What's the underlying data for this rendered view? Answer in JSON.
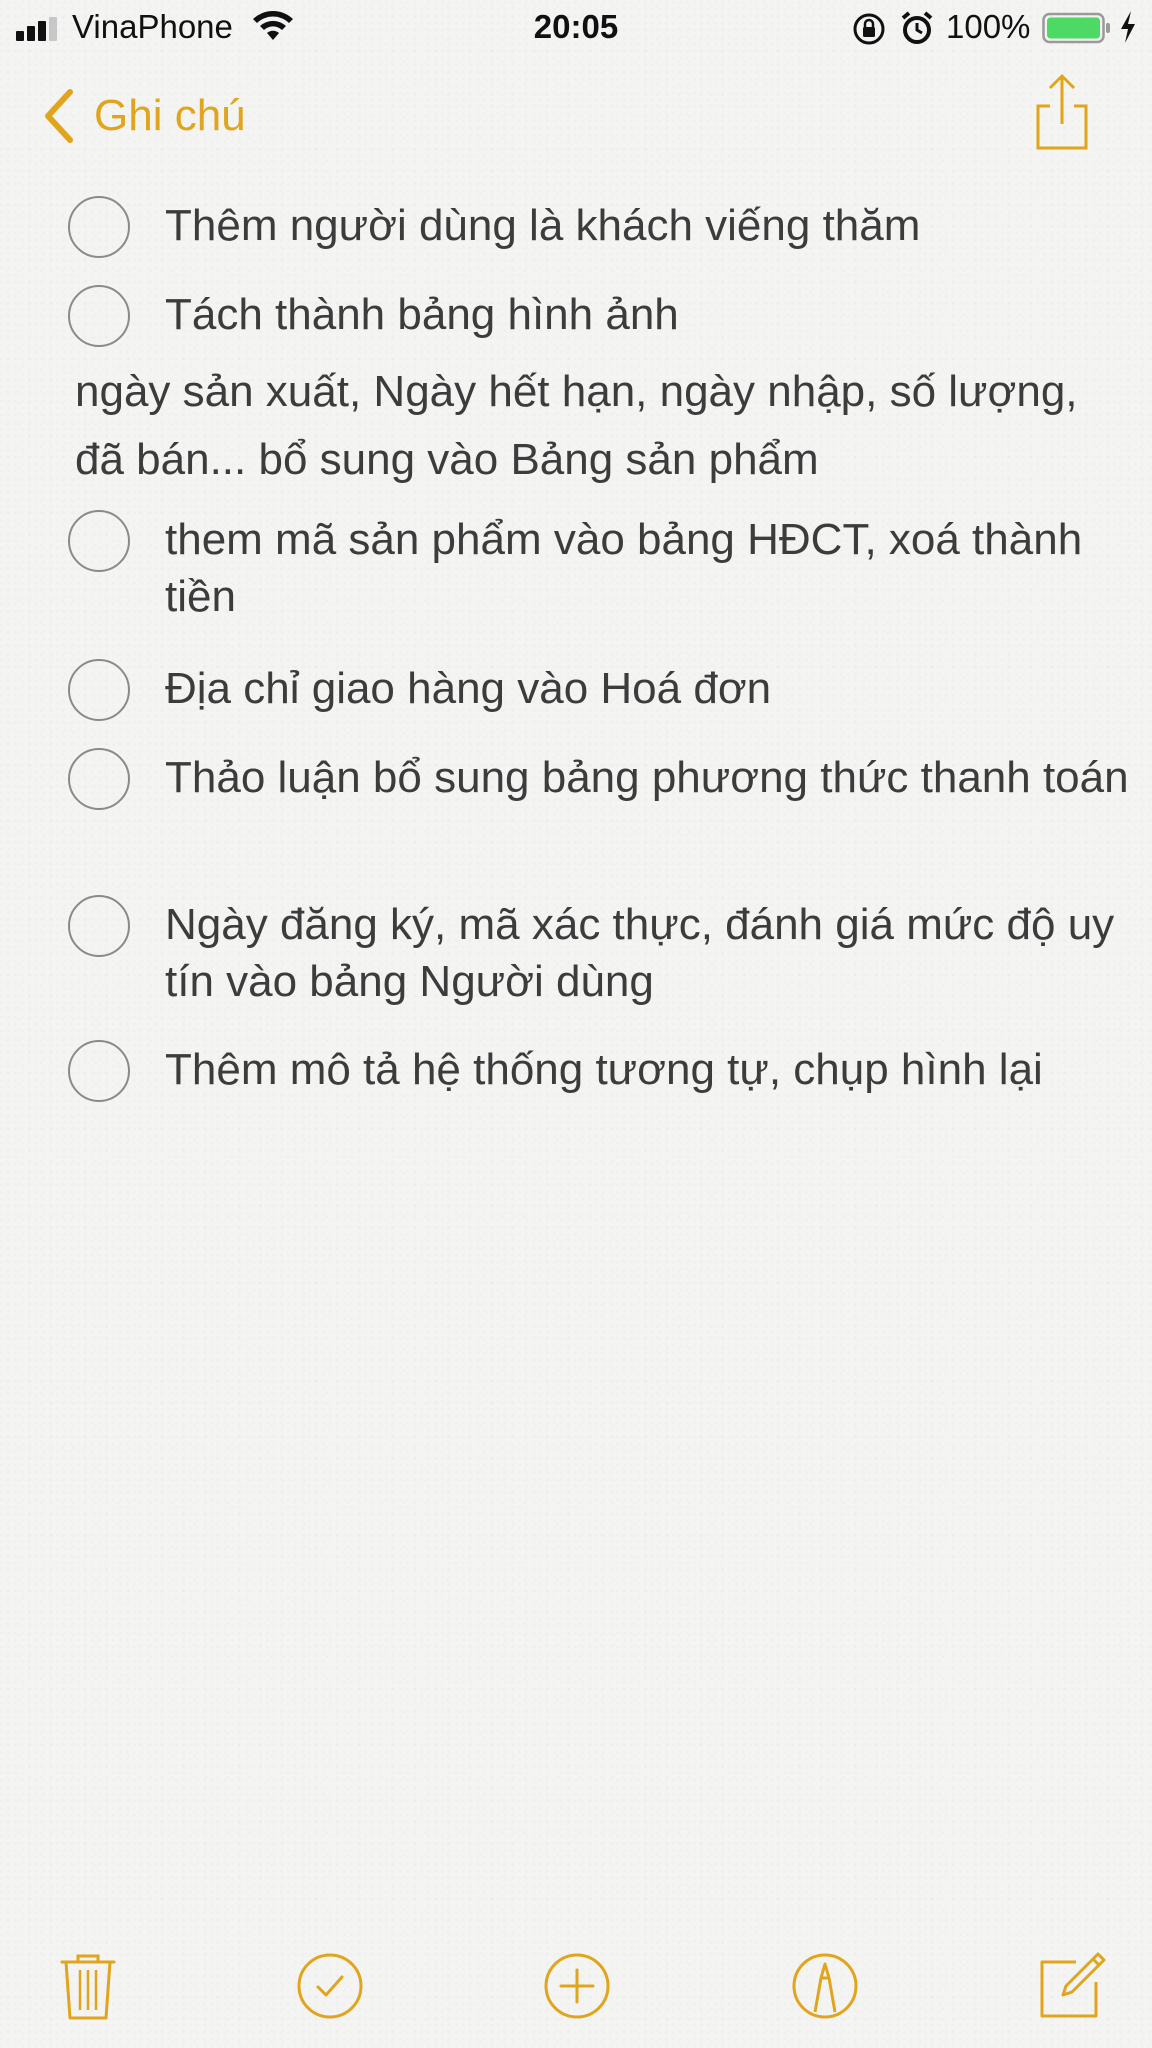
{
  "status_bar": {
    "carrier": "VinaPhone",
    "time": "20:05",
    "battery": "100%"
  },
  "nav": {
    "back_label": "Ghi chú",
    "accent_color": "#e0a51c"
  },
  "checklist": [
    {
      "text": "Thêm người dùng là khách viếng thăm",
      "checked": false
    },
    {
      "text": "Tách thành bảng hình ảnh",
      "checked": false
    },
    {
      "text": "ngày sản xuất, Ngày hết hạn, ngày nhập, số lượng, đã bán... bổ sung vào Bảng sản phẩm",
      "plain": true
    },
    {
      "text": "them mã sản phẩm vào bảng HĐCT, xoá thành tiền",
      "checked": false
    },
    {
      "text": "Địa chỉ giao hàng vào Hoá đơn",
      "checked": false
    },
    {
      "text": "Thảo luận bổ sung bảng phương thức thanh toán",
      "checked": false
    },
    {
      "text": "Ngày đăng ký, mã xác thực, đánh giá mức độ uy tín vào bảng Người dùng",
      "checked": false
    },
    {
      "text": "Thêm mô tả hệ thống tương tự, chụp hình lại",
      "checked": false
    }
  ],
  "toolbar": {
    "icons": [
      "trash-icon",
      "checklist-icon",
      "add-icon",
      "markup-icon",
      "compose-icon"
    ]
  }
}
